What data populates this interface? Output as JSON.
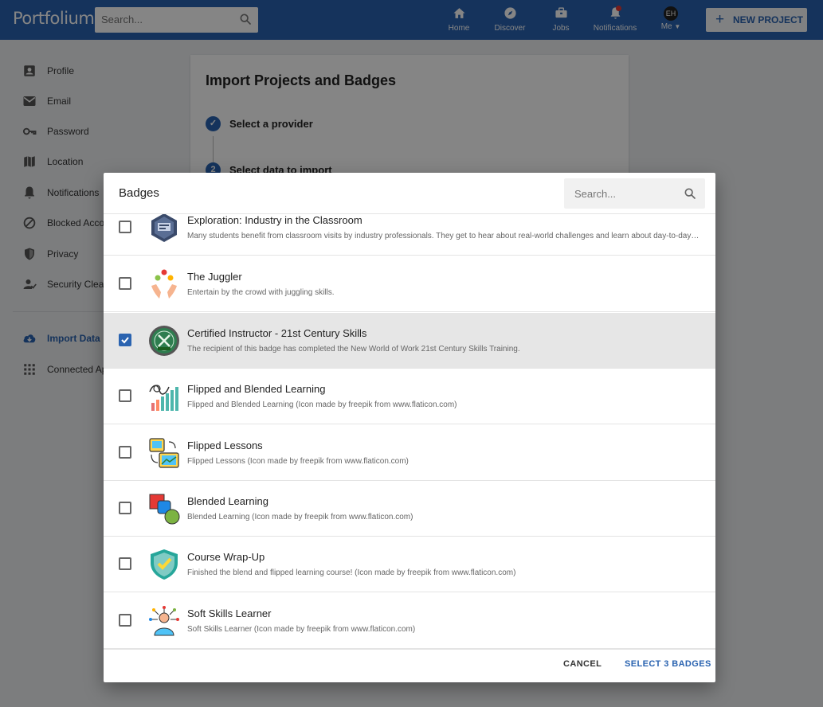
{
  "app": {
    "name": "Portfolium"
  },
  "topnav": {
    "search_placeholder": "Search...",
    "items": [
      {
        "label": "Home",
        "icon": "home-icon"
      },
      {
        "label": "Discover",
        "icon": "compass-icon"
      },
      {
        "label": "Jobs",
        "icon": "briefcase-icon"
      },
      {
        "label": "Notifications",
        "icon": "bell-icon",
        "has_alert": true
      },
      {
        "label": "Me",
        "icon": "avatar",
        "initials": "EH"
      }
    ],
    "new_project_label": "NEW PROJECT"
  },
  "sidebar": {
    "items": [
      {
        "label": "Profile",
        "icon": "profile-icon"
      },
      {
        "label": "Email",
        "icon": "mail-icon"
      },
      {
        "label": "Password",
        "icon": "key-icon"
      },
      {
        "label": "Location",
        "icon": "map-icon"
      },
      {
        "label": "Notifications",
        "icon": "bell-icon"
      },
      {
        "label": "Blocked Accounts",
        "icon": "blocked-icon"
      },
      {
        "label": "Privacy",
        "icon": "shield-icon"
      },
      {
        "label": "Security Clearance",
        "icon": "person-check-icon"
      },
      {
        "label": "Import Data",
        "icon": "cloud-download-icon",
        "active": true
      },
      {
        "label": "Connected Apps",
        "icon": "grid-icon"
      }
    ]
  },
  "import_card": {
    "title": "Import Projects and Badges",
    "steps": [
      {
        "marker": "✓",
        "label": "Select a provider"
      },
      {
        "marker": "2",
        "label": "Select data to import"
      }
    ]
  },
  "modal": {
    "title": "Badges",
    "search_placeholder": "Search...",
    "badges": [
      {
        "name": "Exploration: Industry in the Classroom",
        "description": "Many students benefit from classroom visits by industry professionals. They get to hear about real-world challenges and learn about day-to-day work in their fields.",
        "icon": "industry-badge-icon",
        "checked": false
      },
      {
        "name": "The Juggler",
        "description": "Entertain by the crowd with juggling skills.",
        "icon": "juggler-icon",
        "checked": false
      },
      {
        "name": "Certified Instructor - 21st Century Skills",
        "description": "The recipient of this badge has completed the New World of Work 21st Century Skills Training.",
        "icon": "certified-instructor-icon",
        "checked": true
      },
      {
        "name": "Flipped and Blended Learning",
        "description": "Flipped and Blended Learning (Icon made by freepik from www.flaticon.com)",
        "icon": "growth-chart-icon",
        "checked": false
      },
      {
        "name": "Flipped Lessons",
        "description": "Flipped Lessons (Icon made by freepik from www.flaticon.com)",
        "icon": "flip-images-icon",
        "checked": false
      },
      {
        "name": "Blended Learning",
        "description": "Blended Learning (Icon made by freepik from www.flaticon.com)",
        "icon": "blended-shapes-icon",
        "checked": false
      },
      {
        "name": "Course Wrap-Up",
        "description": "Finished the blend and flipped learning course! (Icon made by freepik from www.flaticon.com)",
        "icon": "shield-check-icon",
        "checked": false
      },
      {
        "name": "Soft Skills Learner",
        "description": "Soft Skills Learner (Icon made by freepik from www.flaticon.com)",
        "icon": "soft-skills-icon",
        "checked": false
      }
    ],
    "cancel_label": "CANCEL",
    "confirm_label": "SELECT 3 BADGES"
  },
  "colors": {
    "brand": "#2a63b0",
    "alert": "#e53935",
    "selected_row": "#e6e6e6"
  }
}
